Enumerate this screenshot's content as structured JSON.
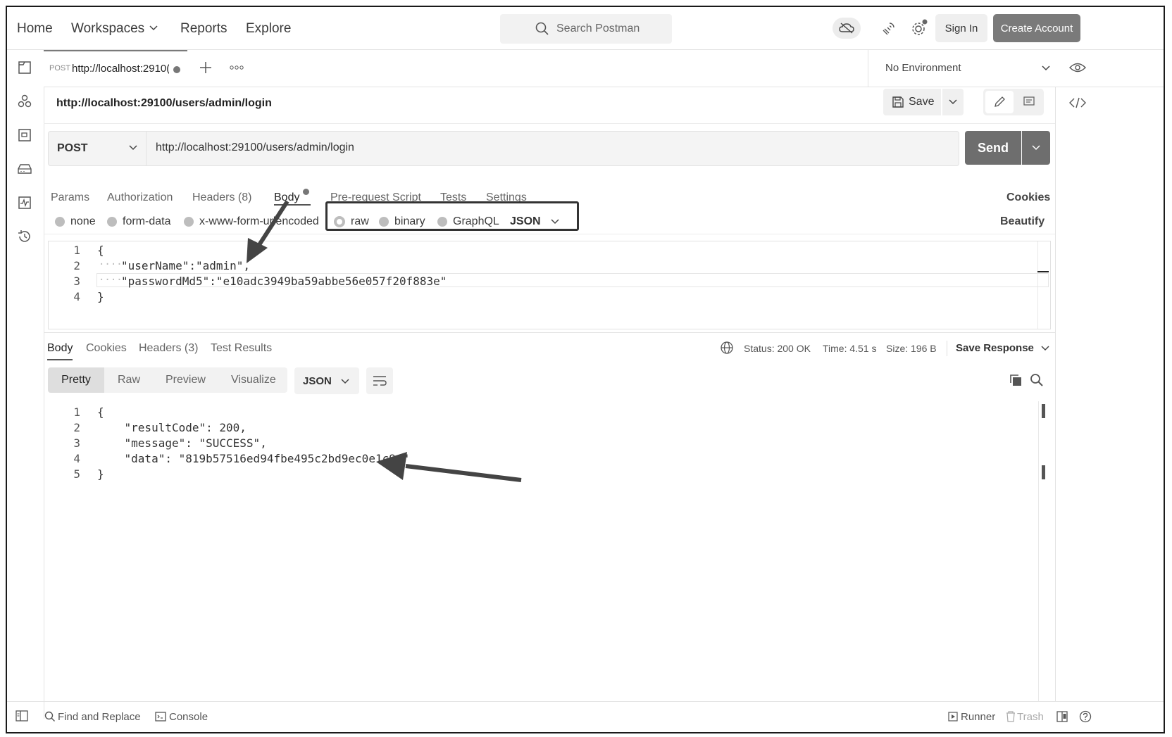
{
  "header": {
    "nav": [
      "Home",
      "Workspaces",
      "Reports",
      "Explore"
    ],
    "search_placeholder": "Search Postman",
    "sign_in": "Sign In",
    "create_account": "Create Account"
  },
  "tab": {
    "method": "POST",
    "url_short": "http://localhost:2910(",
    "environment": "No Environment"
  },
  "request": {
    "title": "http://localhost:29100/users/admin/login",
    "save_label": "Save",
    "method": "POST",
    "url": "http://localhost:29100/users/admin/login",
    "send_label": "Send",
    "tabs": [
      "Params",
      "Authorization",
      "Headers (8)",
      "Body",
      "Pre-request Script",
      "Tests",
      "Settings"
    ],
    "cookies_label": "Cookies",
    "body_modes": [
      "none",
      "form-data",
      "x-www-form-urlencoded",
      "raw",
      "binary",
      "GraphQL"
    ],
    "format": "JSON",
    "beautify_label": "Beautify",
    "body_lines": [
      {
        "num": "1",
        "text": "{"
      },
      {
        "num": "2",
        "text": "\"userName\":\"admin\","
      },
      {
        "num": "3",
        "text": "\"passwordMd5\":\"e10adc3949ba59abbe56e057f20f883e\""
      },
      {
        "num": "4",
        "text": "}"
      }
    ]
  },
  "response": {
    "tabs": [
      "Body",
      "Cookies",
      "Headers (3)",
      "Test Results"
    ],
    "status": "Status: 200 OK",
    "time": "Time: 4.51 s",
    "size": "Size: 196 B",
    "save_response": "Save Response",
    "views": [
      "Pretty",
      "Raw",
      "Preview",
      "Visualize"
    ],
    "format": "JSON",
    "lines": [
      {
        "num": "1",
        "text": "{"
      },
      {
        "num": "2",
        "text": "    \"resultCode\": 200,"
      },
      {
        "num": "3",
        "text": "    \"message\": \"SUCCESS\","
      },
      {
        "num": "4",
        "text": "    \"data\": \"819b57516ed94fbe495c2bd9ec0e1c9a\""
      },
      {
        "num": "5",
        "text": "}"
      }
    ]
  },
  "footer": {
    "find_replace": "Find and Replace",
    "console": "Console",
    "runner": "Runner",
    "trash": "Trash"
  }
}
